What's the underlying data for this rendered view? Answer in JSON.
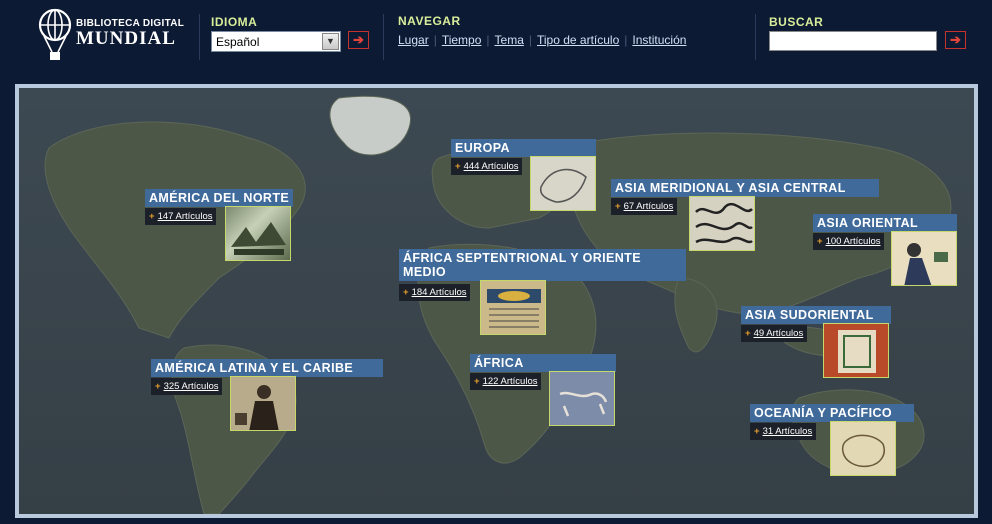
{
  "logo": {
    "line1": "BIBLIOTECA DIGITAL",
    "line2": "MUNDIAL",
    "icon": "globe-balloon-icon"
  },
  "language": {
    "title": "IDIOMA",
    "selected": "Español",
    "go_icon": "arrow-right-icon"
  },
  "navigate": {
    "title": "NAVEGAR",
    "links": [
      "Lugar",
      "Tiempo",
      "Tema",
      "Tipo de artículo",
      "Institución"
    ]
  },
  "search": {
    "title": "BUSCAR",
    "value": "",
    "go_icon": "arrow-right-icon"
  },
  "regions": [
    {
      "name": "AMÉRICA DEL NORTE",
      "count": "147 Artículos"
    },
    {
      "name": "EUROPA",
      "count": "444 Artículos"
    },
    {
      "name": "ASIA MERIDIONAL Y ASIA CENTRAL",
      "count": "67 Artículos"
    },
    {
      "name": "ASIA ORIENTAL",
      "count": "100 Artículos"
    },
    {
      "name": "ÁFRICA SEPTENTRIONAL Y ORIENTE MEDIO",
      "count": "184 Artículos"
    },
    {
      "name": "ASIA SUDORIENTAL",
      "count": "49 Artículos"
    },
    {
      "name": "AMÉRICA LATINA Y EL CARIBE",
      "count": "325 Artículos"
    },
    {
      "name": "ÁFRICA",
      "count": "122 Artículos"
    },
    {
      "name": "OCEANÍA Y PACÍFICO",
      "count": "31 Artículos"
    }
  ],
  "colors": {
    "background": "#0d1a33",
    "accent": "#d8ee9a",
    "region_title_bg": "#3f6a9a",
    "go_button": "#e0443a"
  }
}
